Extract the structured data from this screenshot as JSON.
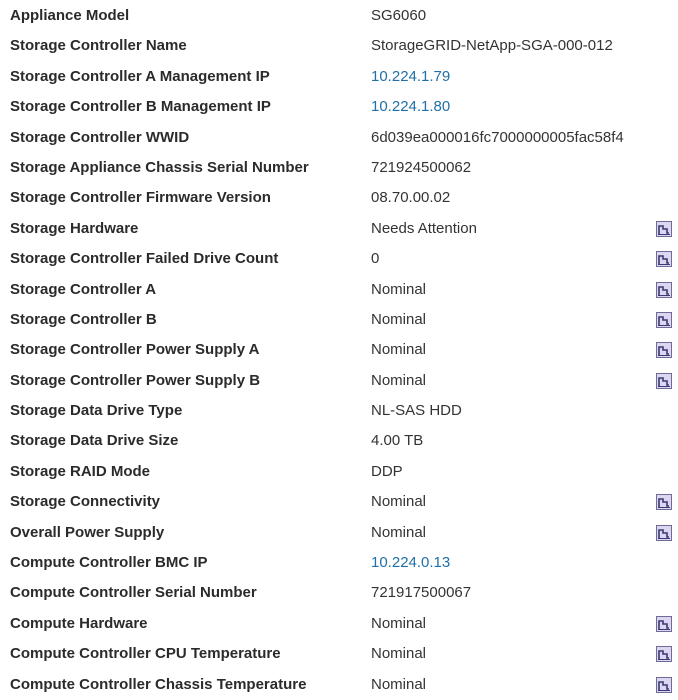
{
  "rows": [
    {
      "label": "Appliance Model",
      "value": "SG6060",
      "link": false,
      "chart": false
    },
    {
      "label": "Storage Controller Name",
      "value": "StorageGRID-NetApp-SGA-000-012",
      "link": false,
      "chart": false
    },
    {
      "label": "Storage Controller A Management IP",
      "value": "10.224.1.79",
      "link": true,
      "chart": false
    },
    {
      "label": "Storage Controller B Management IP",
      "value": "10.224.1.80",
      "link": true,
      "chart": false
    },
    {
      "label": "Storage Controller WWID",
      "value": "6d039ea000016fc7000000005fac58f4",
      "link": false,
      "chart": false
    },
    {
      "label": "Storage Appliance Chassis Serial Number",
      "value": "721924500062",
      "link": false,
      "chart": false
    },
    {
      "label": "Storage Controller Firmware Version",
      "value": "08.70.00.02",
      "link": false,
      "chart": false
    },
    {
      "label": "Storage Hardware",
      "value": "Needs Attention",
      "link": false,
      "chart": true
    },
    {
      "label": "Storage Controller Failed Drive Count",
      "value": "0",
      "link": false,
      "chart": true
    },
    {
      "label": "Storage Controller A",
      "value": "Nominal",
      "link": false,
      "chart": true
    },
    {
      "label": "Storage Controller B",
      "value": "Nominal",
      "link": false,
      "chart": true
    },
    {
      "label": "Storage Controller Power Supply A",
      "value": "Nominal",
      "link": false,
      "chart": true
    },
    {
      "label": "Storage Controller Power Supply B",
      "value": "Nominal",
      "link": false,
      "chart": true
    },
    {
      "label": "Storage Data Drive Type",
      "value": "NL-SAS HDD",
      "link": false,
      "chart": false
    },
    {
      "label": "Storage Data Drive Size",
      "value": "4.00 TB",
      "link": false,
      "chart": false
    },
    {
      "label": "Storage RAID Mode",
      "value": "DDP",
      "link": false,
      "chart": false
    },
    {
      "label": "Storage Connectivity",
      "value": "Nominal",
      "link": false,
      "chart": true
    },
    {
      "label": "Overall Power Supply",
      "value": "Nominal",
      "link": false,
      "chart": true
    },
    {
      "label": "Compute Controller BMC IP",
      "value": "10.224.0.13",
      "link": true,
      "chart": false
    },
    {
      "label": "Compute Controller Serial Number",
      "value": "721917500067",
      "link": false,
      "chart": false
    },
    {
      "label": "Compute Hardware",
      "value": "Nominal",
      "link": false,
      "chart": true
    },
    {
      "label": "Compute Controller CPU Temperature",
      "value": "Nominal",
      "link": false,
      "chart": true
    },
    {
      "label": "Compute Controller Chassis Temperature",
      "value": "Nominal",
      "link": false,
      "chart": true
    }
  ],
  "icons": {
    "chart": "chart-icon"
  },
  "colors": {
    "link": "#1f6fa8",
    "icon_bg": "#dcd6ee",
    "icon_border": "#6e6a9a",
    "icon_line": "#3b3a74"
  }
}
